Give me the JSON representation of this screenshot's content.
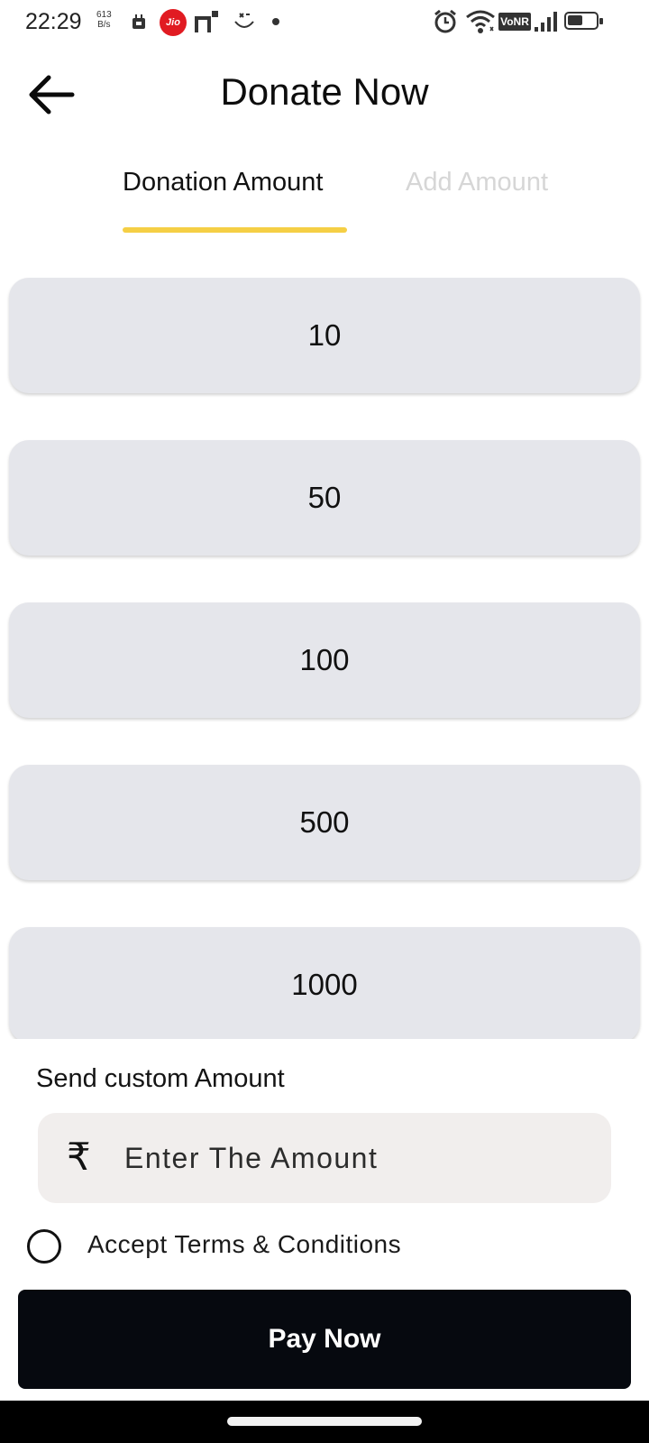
{
  "status_bar": {
    "time": "22:29",
    "net_speed_value": "613",
    "net_speed_unit": "B/s",
    "carrier_badge": "Jio",
    "vonr_label": "VoNR",
    "icons": [
      "video-icon",
      "jio-icon",
      "screen-cast-icon",
      "face-icon",
      "dot-icon",
      "alarm-icon",
      "wifi-icon",
      "vonr-icon",
      "signal-icon",
      "battery-icon"
    ]
  },
  "header": {
    "title": "Donate Now",
    "back_icon": "arrow-left-icon"
  },
  "tabs": [
    {
      "label": "Donation Amount",
      "active": true
    },
    {
      "label": "Add Amount",
      "active": false
    }
  ],
  "amounts": [
    "10",
    "50",
    "100",
    "500",
    "1000"
  ],
  "custom": {
    "label": "Send custom Amount",
    "currency_symbol": "₹",
    "placeholder": "Enter The Amount",
    "value": ""
  },
  "terms": {
    "label": "Accept Terms & Conditions",
    "checked": false
  },
  "pay_button": {
    "label": "Pay Now"
  },
  "colors": {
    "tab_indicator": "#f5cf45",
    "card_bg": "#e5e6eb",
    "input_bg": "#f1eeed",
    "pay_button_bg": "#06090f",
    "inactive_tab": "#d6d6d6",
    "jio_red": "#e11b22"
  }
}
